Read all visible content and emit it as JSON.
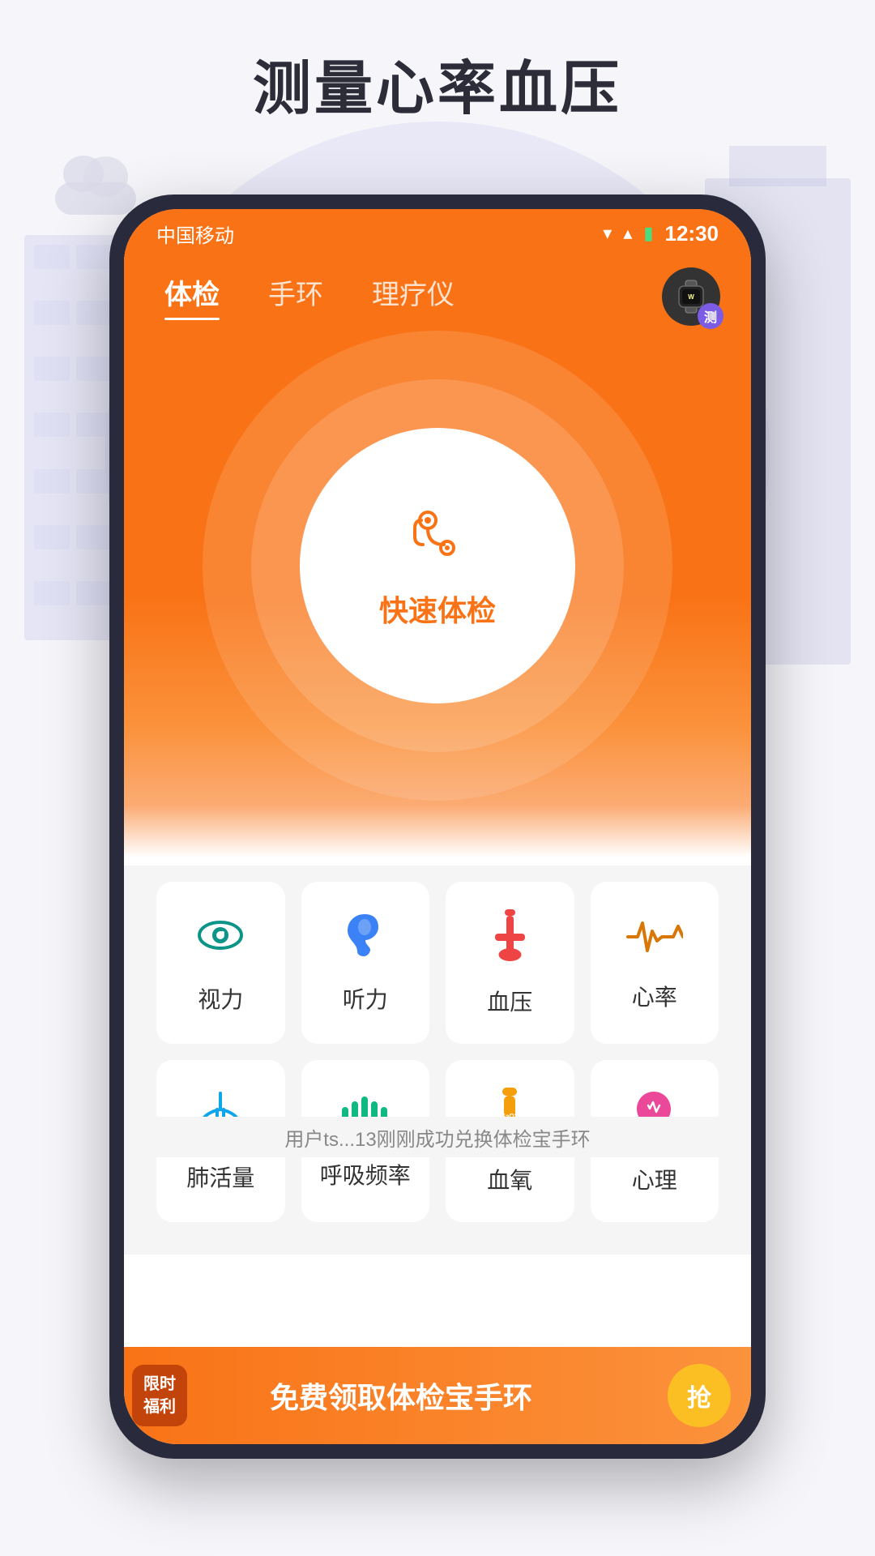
{
  "page": {
    "title": "测量心率血压",
    "background_color": "#f5f5fa"
  },
  "status_bar": {
    "carrier": "中国移动",
    "time": "12:30",
    "wifi_icon": "wifi",
    "signal_icon": "signal",
    "battery_icon": "battery"
  },
  "tabs": [
    {
      "label": "体检",
      "active": true
    },
    {
      "label": "手环",
      "active": false
    },
    {
      "label": "理疗仪",
      "active": false
    }
  ],
  "wristband_badge": "测",
  "quick_exam": {
    "label": "快速体检"
  },
  "grid": {
    "row1": [
      {
        "label": "视力",
        "icon_name": "eye-icon",
        "color": "#0d9488"
      },
      {
        "label": "听力",
        "icon_name": "ear-icon",
        "color": "#3b82f6"
      },
      {
        "label": "血压",
        "icon_name": "bp-icon",
        "color": "#ef4444"
      },
      {
        "label": "心率",
        "icon_name": "hr-icon",
        "color": "#d97706"
      }
    ],
    "row2": [
      {
        "label": "肺活量",
        "icon_name": "lung-icon",
        "color": "#0ea5e9"
      },
      {
        "label": "呼吸频率",
        "icon_name": "breath-icon",
        "color": "#10b981"
      },
      {
        "label": "血氧",
        "icon_name": "sao2-icon",
        "color": "#f59e0b"
      },
      {
        "label": "心理",
        "icon_name": "psych-icon",
        "color": "#ec4899"
      }
    ]
  },
  "marquee": {
    "text": "用户ts...13刚刚成功兑换体检宝手环"
  },
  "banner": {
    "tag": "限时福利",
    "text": "免费领取体检宝手环",
    "button_label": "抢"
  }
}
